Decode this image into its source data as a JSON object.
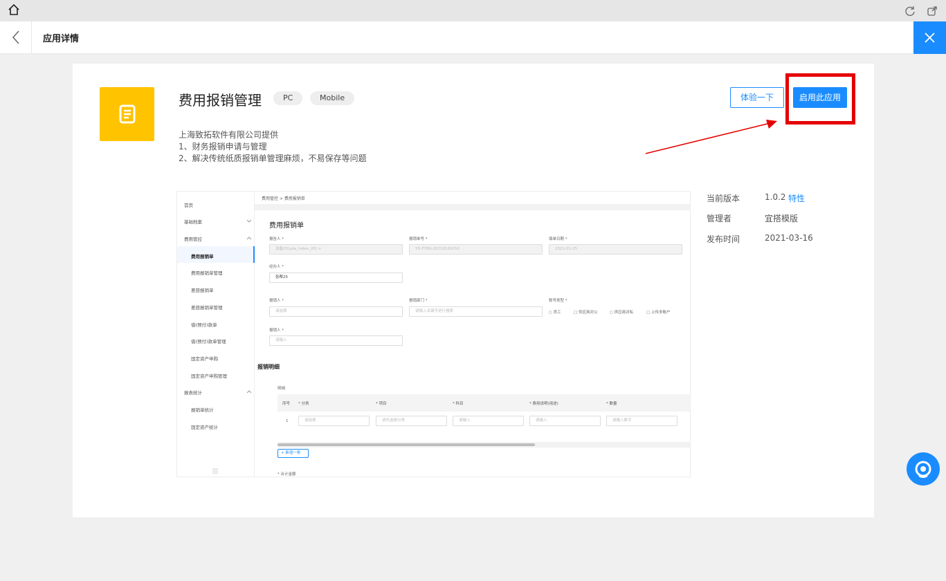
{
  "header": {
    "title": "应用详情"
  },
  "app": {
    "name": "费用报销管理",
    "tags": [
      "PC",
      "Mobile"
    ],
    "provider": "上海致拓软件有限公司提供",
    "desc_lines": [
      "1、财务报销申请与管理",
      "2、解决传统纸质报销单管理麻烦，不易保存等问题"
    ],
    "buttons": {
      "try": "体验一下",
      "enable": "启用此应用"
    }
  },
  "meta": {
    "version_label": "当前版本",
    "version": "1.0.2",
    "features_link": "特性",
    "admin_label": "管理者",
    "admin": "宜搭模版",
    "publish_label": "发布时间",
    "publish_date": "2021-03-16"
  },
  "preview": {
    "sidebar": [
      "首页",
      "基础档案",
      "费用管控",
      "费用报销单",
      "费用报销单管理",
      "差旅报销单",
      "差旅报销单管理",
      "借(预付)款单",
      "借(预付)款单管理",
      "固定资产申购",
      "固定资产申购管理",
      "报表统计",
      "报销单统计",
      "固定资产统计"
    ],
    "breadcrumb": "费用管控  >  费用报销单",
    "form_title": "费用报销单",
    "labels": {
      "applicant": "报告人 *",
      "doc_no": "报销单号 *",
      "fill_date": "填单日期 *",
      "handler": "经办人 *",
      "payee": "报销人 *",
      "dept": "报销部门 *",
      "account_type": "账号类型 *",
      "payee2": "报销人 *"
    },
    "values": {
      "applicant": "设备25(yda_indev_26)  ×",
      "doc_no": "YD-FYBX-20210129250",
      "fill_date": "2021-01-25",
      "handler": "张帮25"
    },
    "placeholders": {
      "select": "请选择",
      "dept": "请输入关键字进行搜索",
      "input": "请输入"
    },
    "account_options": [
      "员工",
      "供应商对公",
      "供应商对私",
      "上传多账户"
    ],
    "detail_title": "报销明细",
    "detail_sub": "明细",
    "columns": [
      "序号",
      "* 分类",
      "* 项目",
      "* 科目",
      "* 费用说明(用途)",
      "* 数量"
    ],
    "row": [
      "1",
      "请选择",
      "请先选择分类",
      "请输入",
      "请输入",
      "请输入数字"
    ],
    "add_row": "+ 新增一条",
    "total_label": "* 合计金额"
  }
}
